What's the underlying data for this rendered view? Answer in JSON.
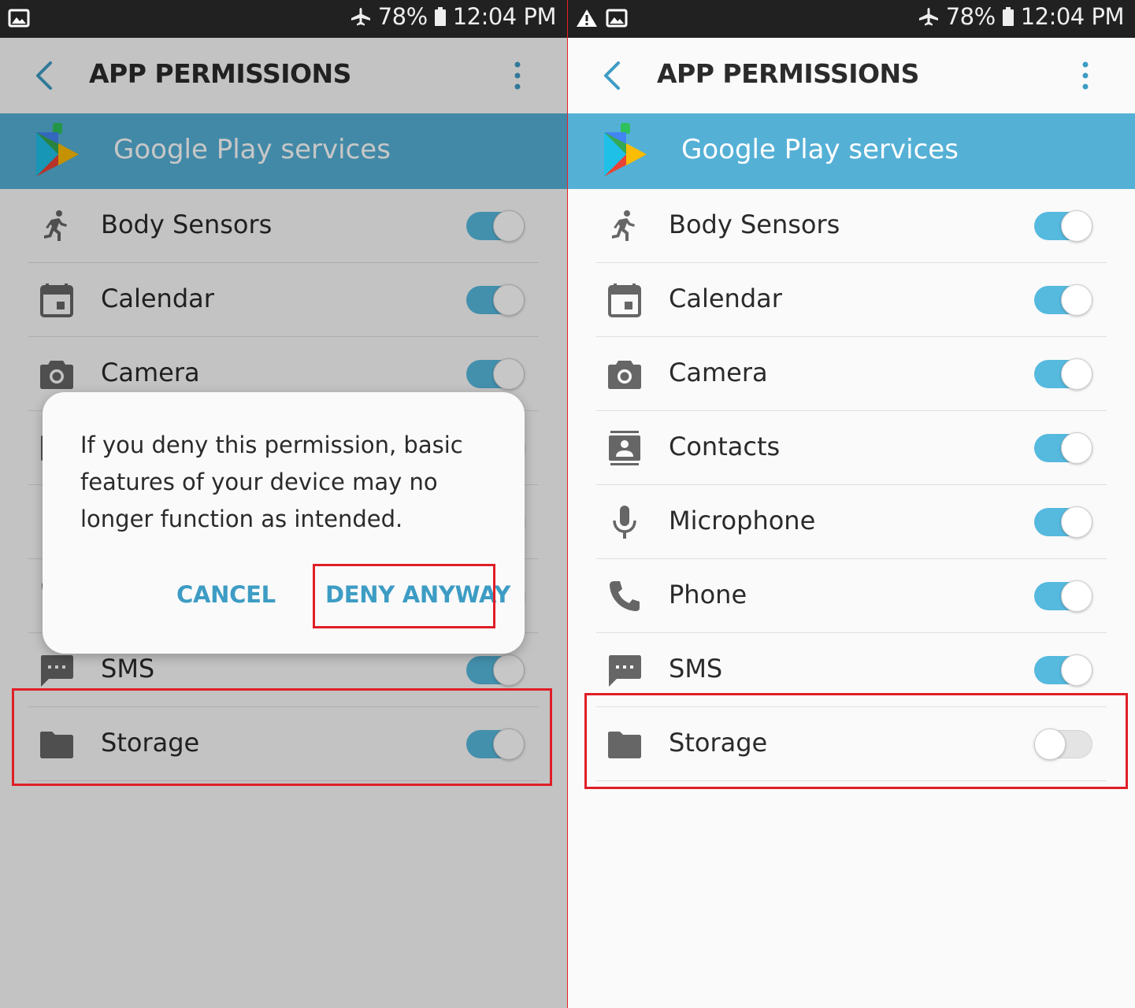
{
  "status_bar": {
    "battery": "78%",
    "time": "12:04 PM"
  },
  "header": {
    "title": "APP PERMISSIONS"
  },
  "banner": {
    "app_name": "Google Play services"
  },
  "permissions": [
    {
      "label": "Body Sensors",
      "icon": "run-icon"
    },
    {
      "label": "Calendar",
      "icon": "calendar-icon"
    },
    {
      "label": "Camera",
      "icon": "camera-icon"
    },
    {
      "label": "Contacts",
      "icon": "contacts-icon"
    },
    {
      "label": "Microphone",
      "icon": "microphone-icon"
    },
    {
      "label": "Phone",
      "icon": "phone-icon"
    },
    {
      "label": "SMS",
      "icon": "sms-icon"
    },
    {
      "label": "Storage",
      "icon": "folder-icon"
    }
  ],
  "left_screen_toggles_on": [
    true,
    true,
    true,
    true,
    true,
    true,
    true,
    true
  ],
  "right_screen_toggles_on": [
    true,
    true,
    true,
    true,
    true,
    true,
    true,
    false
  ],
  "dialog": {
    "message": "If you deny this permission, basic features of your device may no longer function as intended.",
    "cancel_label": "CANCEL",
    "deny_label": "DENY ANYWAY"
  },
  "colors": {
    "accent": "#56b9de",
    "banner": "#55b0d6",
    "highlight": "#e01e26",
    "dialog_button": "#3d9cc4"
  }
}
